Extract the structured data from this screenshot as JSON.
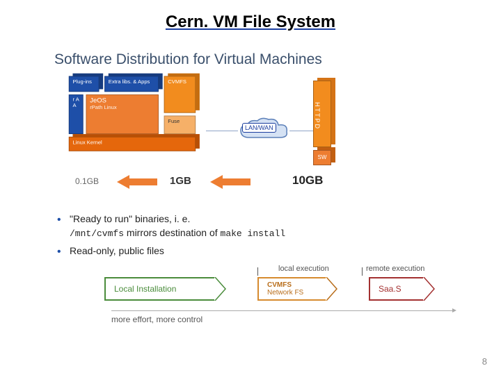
{
  "title": "Cern. VM File System",
  "subtitle": "Software Distribution for Virtual Machines",
  "stack": {
    "plugins": "Plug-ins",
    "extralibs": "Extra libs. & Apps",
    "cvmfs": "CVMFS",
    "raa": "r\nA\nA",
    "jeos_top": "JeOS",
    "jeos_bottom": "rPath Linux",
    "fuse": "Fuse",
    "kernel": "Linux Kernel"
  },
  "server": {
    "httpd": "HTTPD",
    "sw": "SW"
  },
  "cloud_label": "LAN/WAN",
  "sizes": {
    "s1": "0.1GB",
    "s2": "1GB",
    "s3": "10GB"
  },
  "bullets": {
    "b1_a": "\"Ready to run\" binaries, i. e.",
    "b1_b_mono": "/mnt/cvmfs",
    "b1_c": " mirrors destination of ",
    "b1_d_mono": "make  install",
    "b2": "Read-only, public files"
  },
  "d2": {
    "local_exec": "local execution",
    "remote_exec": "remote execution",
    "local_install": "Local Installation",
    "cvmfs": "CVMFS",
    "netfs": "Network FS",
    "saas": "Saa.S",
    "footer": "more effort, more control"
  },
  "page_number": "8"
}
